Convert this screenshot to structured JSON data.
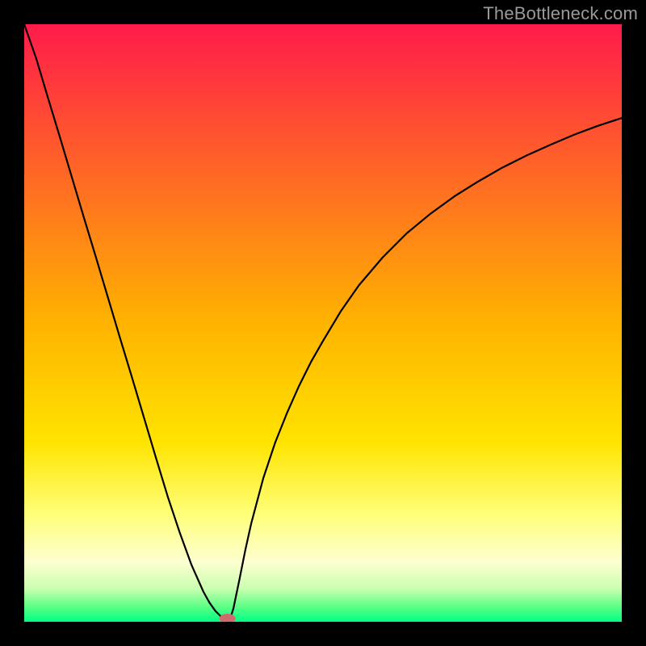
{
  "watermark": "TheBottleneck.com",
  "chart_data": {
    "type": "line",
    "title": "",
    "xlabel": "",
    "ylabel": "",
    "xlim": [
      0,
      100
    ],
    "ylim": [
      0,
      100
    ],
    "grid": false,
    "legend": false,
    "background_gradient_stops": [
      {
        "offset": 0.0,
        "color": "#ff1b4b"
      },
      {
        "offset": 0.5,
        "color": "#ffb300"
      },
      {
        "offset": 0.7,
        "color": "#ffe400"
      },
      {
        "offset": 0.82,
        "color": "#ffff7a"
      },
      {
        "offset": 0.9,
        "color": "#fdffd0"
      },
      {
        "offset": 0.945,
        "color": "#c9ffb0"
      },
      {
        "offset": 0.975,
        "color": "#5bff85"
      },
      {
        "offset": 1.0,
        "color": "#00ff84"
      }
    ],
    "curve": {
      "description": "V-shaped bottleneck curve; y≈0 at x≈34, rising steeply to the left and more slowly to the right",
      "color": "#000000",
      "stroke_width": 2.2,
      "x": [
        0,
        2,
        4,
        6,
        8,
        10,
        12,
        14,
        16,
        18,
        20,
        22,
        24,
        26,
        28,
        30,
        31,
        32,
        33,
        33.5,
        34,
        34.5,
        35,
        36,
        37,
        38,
        40,
        42,
        44,
        46,
        48,
        50,
        53,
        56,
        60,
        64,
        68,
        72,
        76,
        80,
        84,
        88,
        92,
        96,
        100
      ],
      "y": [
        101,
        94.3,
        87.6,
        81,
        74.3,
        67.6,
        61,
        54.3,
        47.6,
        41,
        34.3,
        27.6,
        21,
        15,
        9.5,
        5,
        3.2,
        1.8,
        0.8,
        0.25,
        0,
        0.6,
        2.2,
        7,
        12,
        16.5,
        24,
        30,
        35,
        39.5,
        43.5,
        47,
        52,
        56.3,
        61,
        65,
        68.3,
        71.2,
        73.7,
        76,
        78,
        79.8,
        81.5,
        83,
        84.3
      ]
    },
    "marker": {
      "x": 34,
      "y": 0,
      "color": "#cf6b6b",
      "rx": 10,
      "ry": 6
    }
  }
}
